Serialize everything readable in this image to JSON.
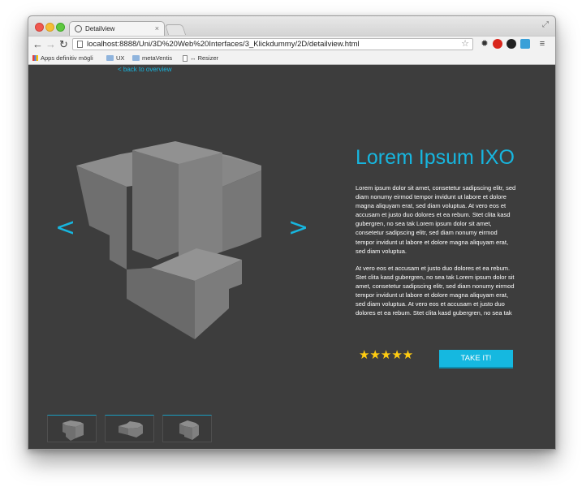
{
  "browser": {
    "tab_title": "Detailview",
    "tab_close": "×",
    "url": "localhost:8888/Uni/3D%20Web%20Interfaces/3_Klickdummy/2D/detailview.html",
    "bookmarks": [
      {
        "label": "Apps definitiv mögli",
        "icon": "apps-icon"
      },
      {
        "label": "UX",
        "icon": "folder-icon"
      },
      {
        "label": "metaVentis",
        "icon": "folder-icon"
      },
      {
        "label": "↔ Resizer",
        "icon": "page-icon"
      }
    ]
  },
  "page": {
    "back_link": "< back to overview",
    "prev_arrow": "<",
    "next_arrow": ">",
    "title": "Lorem Ipsum IXO",
    "paragraphs": [
      "Lorem ipsum dolor sit amet, consetetur sadipscing elitr, sed diam nonumy eirmod tempor invidunt ut labore et dolore magna aliquyam erat, sed diam voluptua. At vero eos et accusam et justo duo dolores et ea rebum. Stet clita kasd gubergren, no sea tak Lorem ipsum dolor sit amet, consetetur sadipscing elitr, sed diam nonumy eirmod tempor invidunt ut labore et dolore magna aliquyam erat, sed diam voluptua.",
      "At vero eos et accusam et justo duo dolores et ea rebum. Stet clita kasd gubergren, no sea tak Lorem ipsum dolor sit amet, consetetur sadipscing elitr, sed diam nonumy eirmod tempor invidunt ut labore et dolore magna aliquyam erat, sed diam voluptua. At vero eos et accusam et justo duo dolores et ea rebum. Stet clita kasd gubergren, no sea tak"
    ],
    "rating": {
      "value": 5,
      "max": 5,
      "stars": "★★★★★"
    },
    "cta_label": "TAKE IT!",
    "thumbnails": [
      "thumbnail-1",
      "thumbnail-2",
      "thumbnail-3"
    ]
  },
  "colors": {
    "accent": "#17b6df",
    "background": "#3d3d3d",
    "star": "#ffcc11"
  }
}
